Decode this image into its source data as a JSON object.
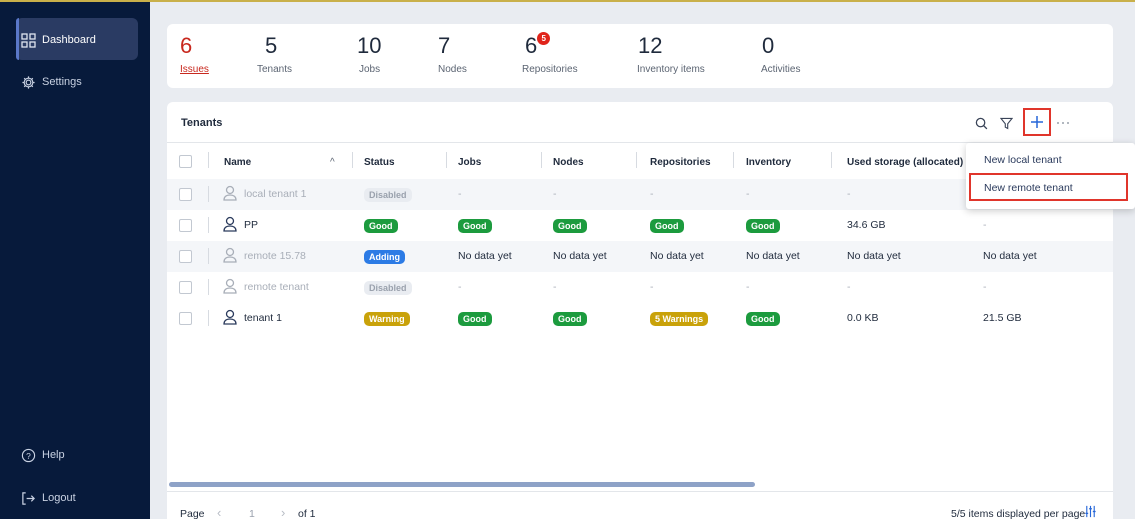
{
  "sidebar": {
    "items": [
      {
        "label": "Dashboard",
        "icon": "dashboard-icon",
        "active": true
      },
      {
        "label": "Settings",
        "icon": "gear-icon"
      }
    ],
    "bottom": [
      {
        "label": "Help",
        "icon": "help-icon"
      },
      {
        "label": "Logout",
        "icon": "logout-icon"
      }
    ]
  },
  "stats": [
    {
      "value": "6",
      "label": "Issues",
      "color": "#c8281e"
    },
    {
      "value": "5",
      "label": "Tenants"
    },
    {
      "value": "10",
      "label": "Jobs"
    },
    {
      "value": "7",
      "label": "Nodes"
    },
    {
      "value": "6",
      "label": "Repositories",
      "badge": "5"
    },
    {
      "value": "12",
      "label": "Inventory items"
    },
    {
      "value": "0",
      "label": "Activities"
    }
  ],
  "tenants": {
    "title": "Tenants",
    "columns": [
      "Name",
      "Status",
      "Jobs",
      "Nodes",
      "Repositories",
      "Inventory",
      "Used storage (allocated)"
    ],
    "sort_indicator": "^",
    "rows": [
      {
        "name": "local tenant 1",
        "status": "Disabled",
        "jobs": "-",
        "nodes": "-",
        "repositories": "-",
        "inventory": "-",
        "used": "-",
        "extra": "",
        "disabled": true
      },
      {
        "name": "PP",
        "status": "Good",
        "jobs": "Good",
        "nodes": "Good",
        "repositories": "Good",
        "inventory": "Good",
        "used": "34.6 GB",
        "extra": "-"
      },
      {
        "name": "remote 15.78",
        "status": "Adding",
        "jobs": "No data yet",
        "nodes": "No data yet",
        "repositories": "No data yet",
        "inventory": "No data yet",
        "used": "No data yet",
        "extra": "No data yet"
      },
      {
        "name": "remote tenant",
        "status": "Disabled",
        "jobs": "-",
        "nodes": "-",
        "repositories": "-",
        "inventory": "-",
        "used": "-",
        "extra": "-",
        "disabled": true
      },
      {
        "name": "tenant 1",
        "status": "Warning",
        "jobs": "Good",
        "nodes": "Good",
        "repositories": "5 Warnings",
        "inventory": "Good",
        "used": "0.0 KB",
        "extra": "21.5 GB"
      }
    ]
  },
  "menu": {
    "items": [
      "New local tenant",
      "New remote tenant"
    ]
  },
  "footer": {
    "page_label": "Page",
    "page_value": "1",
    "of_label": "of 1",
    "items_per_page": "5/5 items displayed per page"
  },
  "colors": {
    "sidebar": "#071a3b",
    "good": "#1c9b3e",
    "adding": "#2c7be5",
    "warning": "#c9a20a",
    "highlight": "#e0352b"
  }
}
